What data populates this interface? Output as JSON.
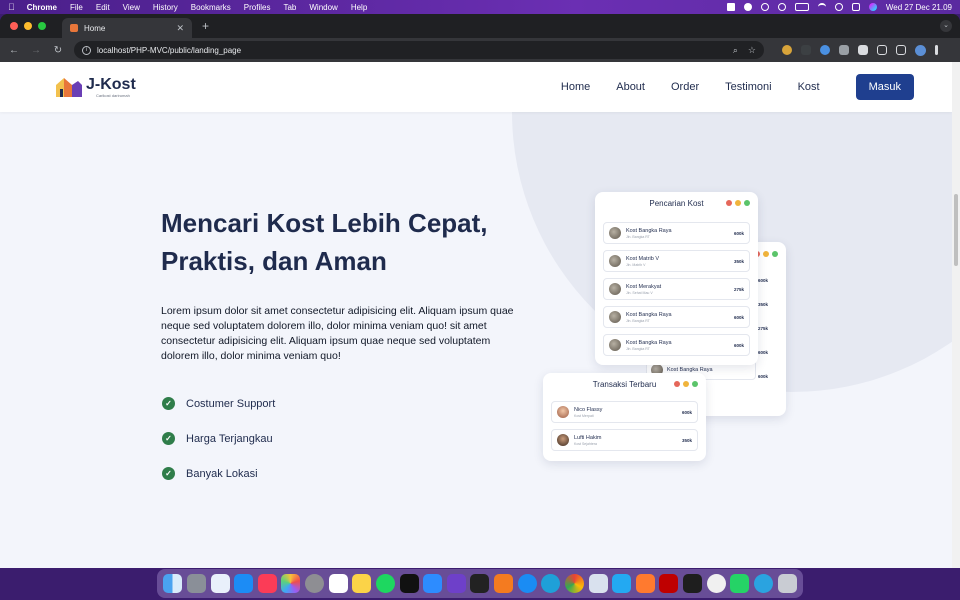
{
  "menubar": {
    "app": "Chrome",
    "items": [
      "File",
      "Edit",
      "View",
      "History",
      "Bookmarks",
      "Profiles",
      "Tab",
      "Window",
      "Help"
    ],
    "clock": "Wed 27 Dec  21.09"
  },
  "browser": {
    "tab_title": "Home",
    "url": "localhost/PHP-MVC/public/landing_page"
  },
  "navbar": {
    "logo": "J-Kost",
    "logo_sub": "Carikost darirumah",
    "links": [
      "Home",
      "About",
      "Order",
      "Testimoni",
      "Kost"
    ],
    "cta": "Masuk"
  },
  "hero": {
    "title_line1": "Mencari Kost Lebih Cepat,",
    "title_line2": "Praktis, dan Aman",
    "description": "Lorem ipsum dolor sit amet consectetur adipisicing elit. Aliquam ipsum quae neque sed voluptatem dolorem illo, dolor minima veniam quo! sit amet consectetur adipisicing elit. Aliquam ipsum quae neque sed voluptatem dolorem illo, dolor minima veniam quo!",
    "features": [
      "Costumer Support",
      "Harga Terjangkau",
      "Banyak Lokasi"
    ]
  },
  "search_card": {
    "title": "Pencarian Kost",
    "rows": [
      {
        "name": "Kost Bangka Raya",
        "sub": "Jln. Bangka RT",
        "price": "600k"
      },
      {
        "name": "Kost Matrib V",
        "sub": "Jln. Matrib V",
        "price": "350k"
      },
      {
        "name": "Kost Merakyat",
        "sub": "Jln. Sehat Mau V",
        "price": "275k"
      },
      {
        "name": "Kost Bangka Raya",
        "sub": "Jln. Bangka RT",
        "price": "600k"
      },
      {
        "name": "Kost Bangka Raya",
        "sub": "Jln. Bangka RT",
        "price": "600k"
      }
    ]
  },
  "back_card": {
    "row_label": "Kost Bangka Raya",
    "prices": [
      "600k",
      "350k",
      "275k",
      "600k",
      "600k"
    ]
  },
  "transaction_card": {
    "title": "Transaksi Terbaru",
    "rows": [
      {
        "name": "Nico Flassy",
        "sub": "Kost Merpati",
        "price": "600k"
      },
      {
        "name": "Lufti Hakim",
        "sub": "Kost Sejahtera",
        "price": "350k"
      }
    ]
  },
  "colors": {
    "navy": "#1f2b4d",
    "button": "#1f3f8f",
    "check": "#2f7d4a",
    "dot_red": "#e5675a",
    "dot_yellow": "#f0b43c",
    "dot_green": "#5bc46a"
  }
}
